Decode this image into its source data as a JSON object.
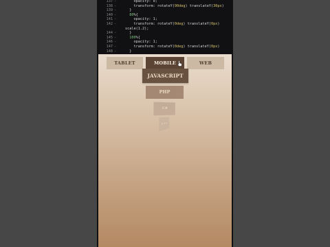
{
  "code_lines": [
    {
      "num": "137",
      "parts": [
        {
          "t": "    opacity: 0;",
          "c": ""
        }
      ]
    },
    {
      "num": "138",
      "parts": [
        {
          "t": "    transform: rotateY(",
          "c": ""
        },
        {
          "t": "90deg",
          "c": "y"
        },
        {
          "t": ") translateY(",
          "c": ""
        },
        {
          "t": "30px",
          "c": "y"
        },
        {
          "t": ")",
          "c": ""
        }
      ]
    },
    {
      "num": "139",
      "parts": [
        {
          "t": "  }",
          "c": ""
        }
      ]
    },
    {
      "num": "140",
      "parts": [
        {
          "t": "  ",
          "c": ""
        },
        {
          "t": "80",
          "c": "g"
        },
        {
          "t": "%{",
          "c": ""
        }
      ]
    },
    {
      "num": "141",
      "parts": [
        {
          "t": "    opacity: 1;",
          "c": ""
        }
      ]
    },
    {
      "num": "142",
      "parts": [
        {
          "t": "    transform: rotateY(",
          "c": ""
        },
        {
          "t": "0deg",
          "c": "y"
        },
        {
          "t": ") translateY(",
          "c": ""
        },
        {
          "t": "0px",
          "c": "y"
        },
        {
          "t": ")",
          "c": ""
        }
      ]
    },
    {
      "num": "",
      "parts": [
        {
          "t": "scale(1.2);",
          "c": ""
        }
      ]
    },
    {
      "num": "144",
      "parts": [
        {
          "t": "  }",
          "c": ""
        }
      ]
    },
    {
      "num": "145",
      "parts": [
        {
          "t": "  ",
          "c": ""
        },
        {
          "t": "100",
          "c": "g"
        },
        {
          "t": "%{",
          "c": ""
        }
      ]
    },
    {
      "num": "146",
      "parts": [
        {
          "t": "    opacity: 1;",
          "c": ""
        }
      ]
    },
    {
      "num": "147",
      "parts": [
        {
          "t": "    transform: rotateY(",
          "c": ""
        },
        {
          "t": "0deg",
          "c": "y"
        },
        {
          "t": ") translateY(",
          "c": ""
        },
        {
          "t": "0px",
          "c": "y"
        },
        {
          "t": ")",
          "c": ""
        }
      ]
    },
    {
      "num": "148",
      "parts": [
        {
          "t": "  }",
          "c": ""
        }
      ]
    }
  ],
  "tabs": [
    {
      "label": "TABLET",
      "active": false
    },
    {
      "label": "MOBILE",
      "active": true
    },
    {
      "label": "WEB",
      "active": false
    }
  ],
  "cards": [
    {
      "label": "JAVASCRIPT"
    },
    {
      "label": "PHP"
    },
    {
      "label": "C#"
    },
    {
      "label": "C++"
    }
  ],
  "colors": {
    "tab_active": "#5b4433",
    "tab_inactive": "#ccb9a3",
    "card_primary": "#6a5240",
    "stage_top": "#e9dccd",
    "stage_bottom": "#b38962",
    "editor_bg": "#111114",
    "side_bg": "#474747"
  },
  "icons": [
    "hand-pointer-icon"
  ]
}
